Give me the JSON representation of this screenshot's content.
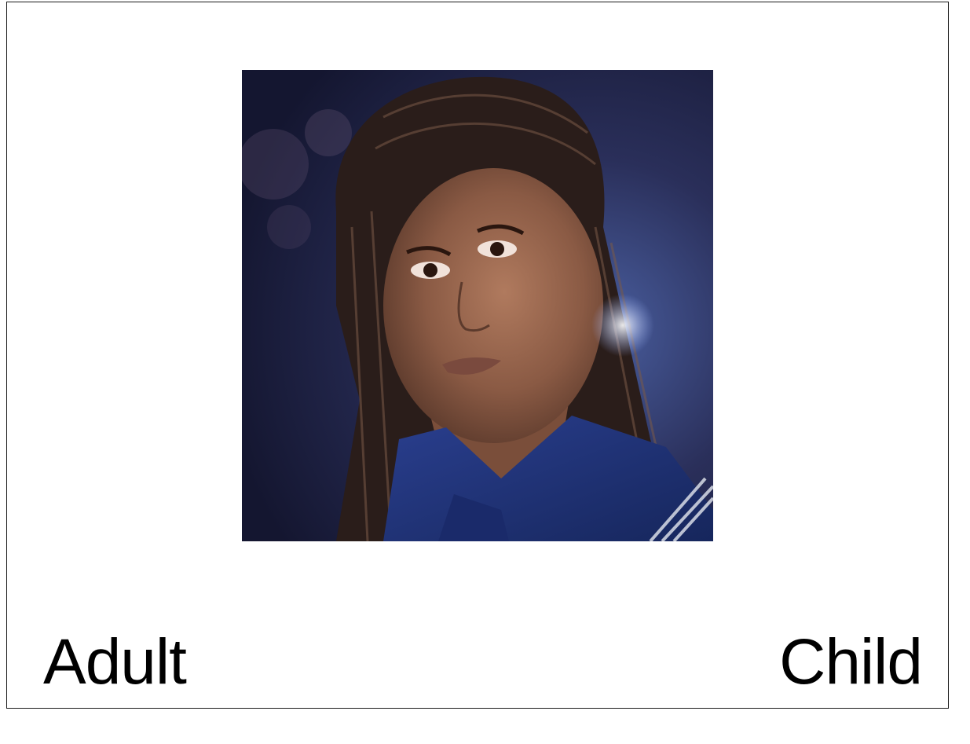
{
  "card": {
    "left_option": "Adult",
    "right_option": "Child"
  },
  "image": {
    "subject": "portrait-photo",
    "colors": {
      "background_dark": "#1c1f3d",
      "background_glow": "#3b4c8a",
      "skin": "#8a5a44",
      "uniform": "#1f3277",
      "hair": "#2a1d1a"
    }
  }
}
